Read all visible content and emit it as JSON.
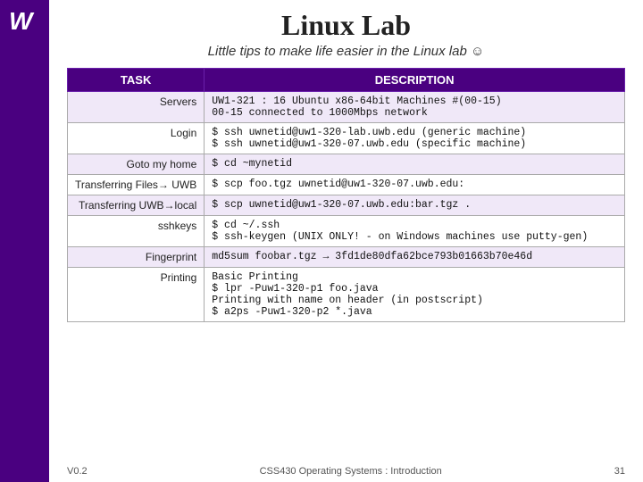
{
  "logo": "W",
  "title": "Linux Lab",
  "subtitle": "Little tips to make life easier in the Linux lab ☺",
  "table": {
    "headers": [
      "TASK",
      "DESCRIPTION"
    ],
    "rows": [
      {
        "task": "Servers",
        "desc": "UW1-321 : 16 Ubuntu x86-64bit Machines #(00-15)\n          00-15 connected to 1000Mbps network"
      },
      {
        "task": "Login",
        "desc": "$ ssh uwnetid@uw1-320-lab.uwb.edu (generic machine)\n$ ssh uwnetid@uw1-320-07.uwb.edu  (specific machine)"
      },
      {
        "task": "Goto my home",
        "desc": "$ cd ~mynetid"
      },
      {
        "task": "Transferring Files→ UWB",
        "desc": "$ scp foo.tgz uwnetid@uw1-320-07.uwb.edu:"
      },
      {
        "task": "Transferring UWB→local",
        "desc": "$ scp uwnetid@uw1-320-07.uwb.edu:bar.tgz ."
      },
      {
        "task": "sshkeys",
        "desc": "$ cd ~/.ssh\n$ ssh-keygen (UNIX ONLY! - on Windows machines use putty-gen)"
      },
      {
        "task": "Fingerprint",
        "desc": "md5sum foobar.tgz → 3fd1de80dfa62bce793b01663b70e46d"
      },
      {
        "task": "Printing",
        "desc": "Basic Printing\n$ lpr -Puw1-320-p1 foo.java\nPrinting with name on header (in postscript)\n$ a2ps -Puw1-320-p2 *.java"
      }
    ]
  },
  "footer": {
    "left": "V0.2",
    "course": "CSS430 Operating Systems : Introduction",
    "page": "31"
  }
}
